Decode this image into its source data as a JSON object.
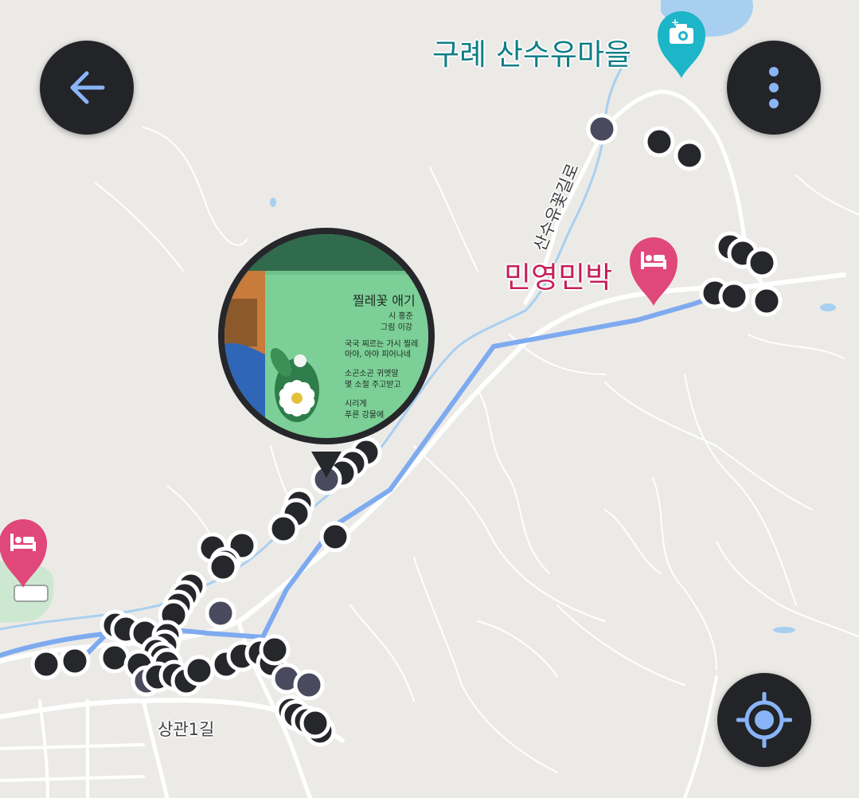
{
  "map": {
    "pois": [
      {
        "name": "구례 산수유마을",
        "kind": "photo-spot",
        "color": "#1db5c8"
      },
      {
        "name": "민영민박",
        "kind": "lodging",
        "color": "#e0477a"
      },
      {
        "name": "",
        "kind": "lodging",
        "color": "#e0477a"
      }
    ],
    "road_labels": [
      "산수유꽃길로",
      "상관1길"
    ],
    "route_color": "#7eaaf0",
    "marker_color": "#26272b",
    "selected_marker_color": "#4a4a5e"
  },
  "photo_preview": {
    "sign_title": "찔레꽃 애기",
    "sign_lines": [
      "시 홍준",
      "그림 이강",
      "국국 찌르는 가시 찔레",
      "아야, 아야 피어나네",
      "소곤소곤 귀엣말",
      "몇 소절 주고받고",
      "시리게",
      "푸른 강물에"
    ]
  },
  "controls": {
    "back_icon": "arrow-left-icon",
    "menu_icon": "more-vertical-icon",
    "locate_icon": "my-location-icon"
  }
}
